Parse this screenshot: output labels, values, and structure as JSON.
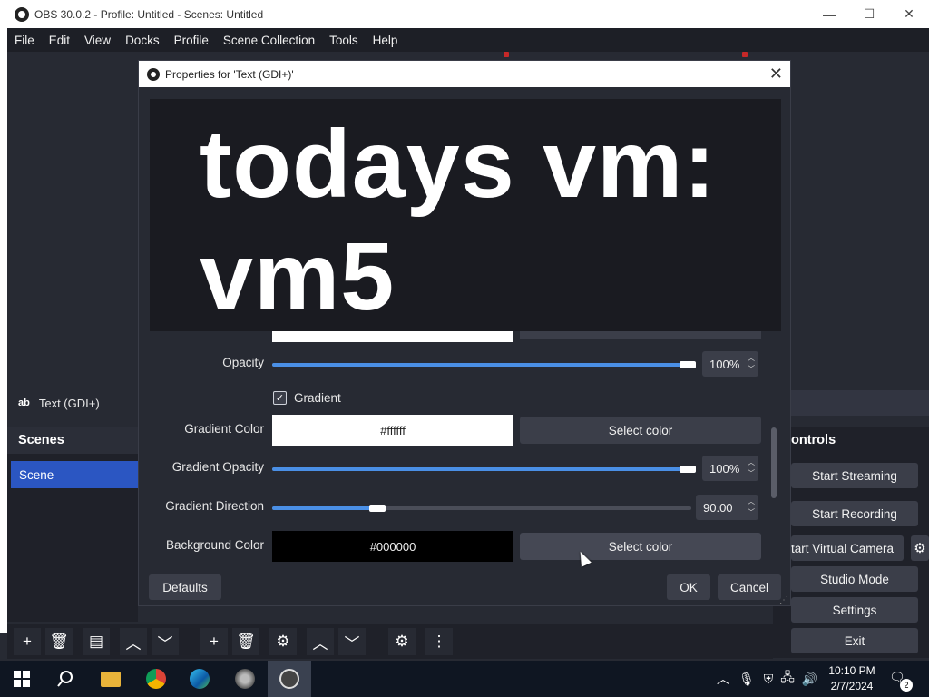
{
  "window": {
    "title": "OBS 30.0.2 - Profile: Untitled - Scenes: Untitled",
    "minimize": "—",
    "maximize": "☐",
    "close": "✕"
  },
  "menubar": [
    "File",
    "Edit",
    "View",
    "Docks",
    "Profile",
    "Scene Collection",
    "Tools",
    "Help"
  ],
  "sources": {
    "selected_icon": "ab",
    "selected_label": "Text (GDI+)"
  },
  "scenes": {
    "header": "Scenes",
    "items": [
      "Scene"
    ]
  },
  "controls": {
    "header": "ontrols",
    "buttons": [
      "Start Streaming",
      "Start Recording",
      "tart Virtual Camera",
      "Studio Mode",
      "Settings",
      "Exit"
    ]
  },
  "dialog": {
    "title": "Properties for 'Text (GDI+)'",
    "close": "✕",
    "preview_text_line1": "todays vm:",
    "preview_text_line2": "vm5",
    "opacity_label": "Opacity",
    "opacity_value": "100%",
    "opacity_fraction": 1.0,
    "gradient_checkbox_label": "Gradient",
    "gradient_checked": true,
    "gradient_color_label": "Gradient Color",
    "gradient_color_value": "#ffffff",
    "select_color": "Select color",
    "gradient_opacity_label": "Gradient Opacity",
    "gradient_opacity_value": "100%",
    "gradient_opacity_fraction": 1.0,
    "gradient_direction_label": "Gradient Direction",
    "gradient_direction_value": "90.00",
    "gradient_direction_fraction": 0.25,
    "background_color_label": "Background Color",
    "background_color_value": "#000000",
    "defaults_button": "Defaults",
    "ok_button": "OK",
    "cancel_button": "Cancel"
  },
  "taskbar": {
    "time": "10:10 PM",
    "date": "2/7/2024",
    "notifications": "2"
  },
  "colors": {
    "accent": "#2b56c2",
    "slider": "#4a8fe6",
    "panel": "#272a33"
  }
}
